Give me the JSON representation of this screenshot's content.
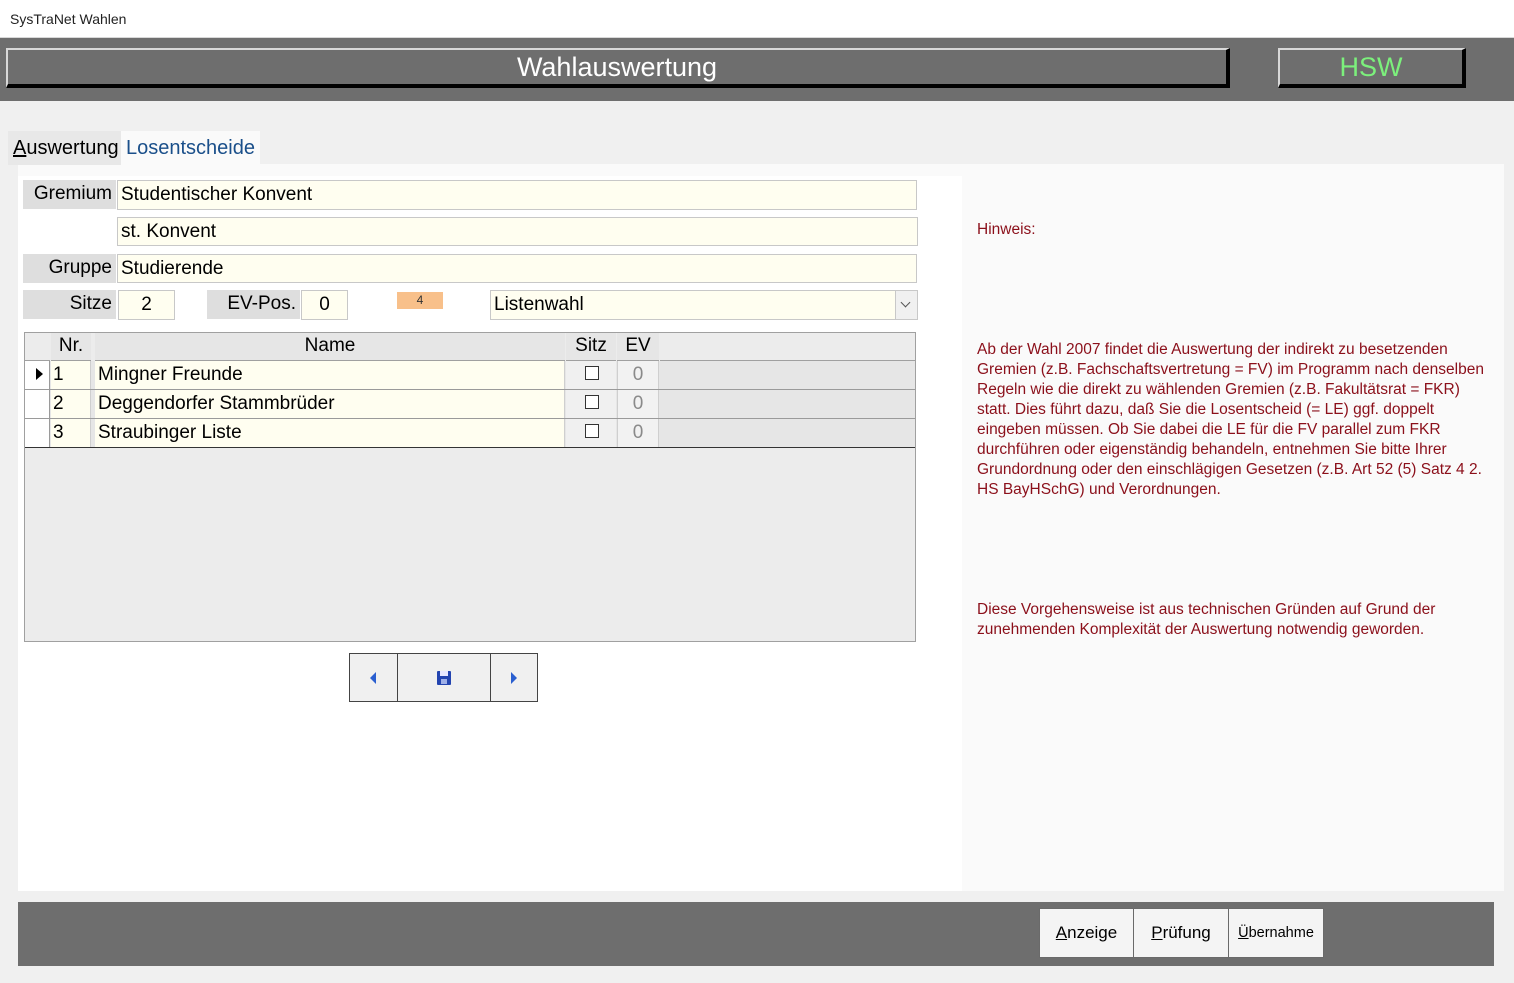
{
  "window": {
    "title": "SysTraNet Wahlen"
  },
  "header": {
    "title": "Wahlauswertung",
    "badge": "HSW"
  },
  "tabs": [
    {
      "label_u": "A",
      "label_rest": "uswertung"
    },
    {
      "label_u": "L",
      "label_rest": "osentscheide"
    }
  ],
  "form": {
    "gremium_label": "Gremium",
    "gremium_value": "Studentischer Konvent",
    "gremium_short": "st. Konvent",
    "gruppe_label": "Gruppe",
    "gruppe_value": "Studierende",
    "sitze_label": "Sitze",
    "sitze_value": "2",
    "evpos_label": "EV-Pos.",
    "evpos_value": "0",
    "count_badge": "4",
    "wahlart_value": "Listenwahl"
  },
  "grid": {
    "headers": {
      "nr": "Nr.",
      "name": "Name",
      "sitz": "Sitz",
      "ev": "EV"
    },
    "rows": [
      {
        "nr": "1",
        "name": "Mingner Freunde",
        "ev": "0"
      },
      {
        "nr": "2",
        "name": "Deggendorfer Stammbrüder",
        "ev": "0"
      },
      {
        "nr": "3",
        "name": "Straubinger Liste",
        "ev": "0"
      }
    ]
  },
  "hint": {
    "title": "Hinweis:",
    "paragraph1": "Ab der Wahl 2007 findet die Auswertung der indirekt zu besetzenden Gremien (z.B. Fachschaftsvertretung = FV) im Programm nach denselben Regeln wie die direkt zu wählenden Gremien (z.B. Fakultätsrat = FKR) statt. Dies führt dazu, daß Sie die Losentscheid (= LE) ggf. doppelt eingeben müssen. Ob Sie dabei die LE für die FV parallel zum FKR durchführen oder eigenständig behandeln, entnehmen Sie bitte Ihrer Grundordnung oder den einschlägigen Gesetzen (z.B. Art 52 (5) Satz 4 2. HS BayHSchG) und Verordnungen.",
    "paragraph2": "Diese Vorgehensweise ist aus technischen Gründen auf Grund der zunehmenden Komplexität der Auswertung notwendig geworden."
  },
  "footer": {
    "anzeige_u": "A",
    "anzeige_rest": "nzeige",
    "pruefung_u": "P",
    "pruefung_rest": "rüfung",
    "uebernahme_u": "Ü",
    "uebernahme_rest": "bernahme"
  }
}
